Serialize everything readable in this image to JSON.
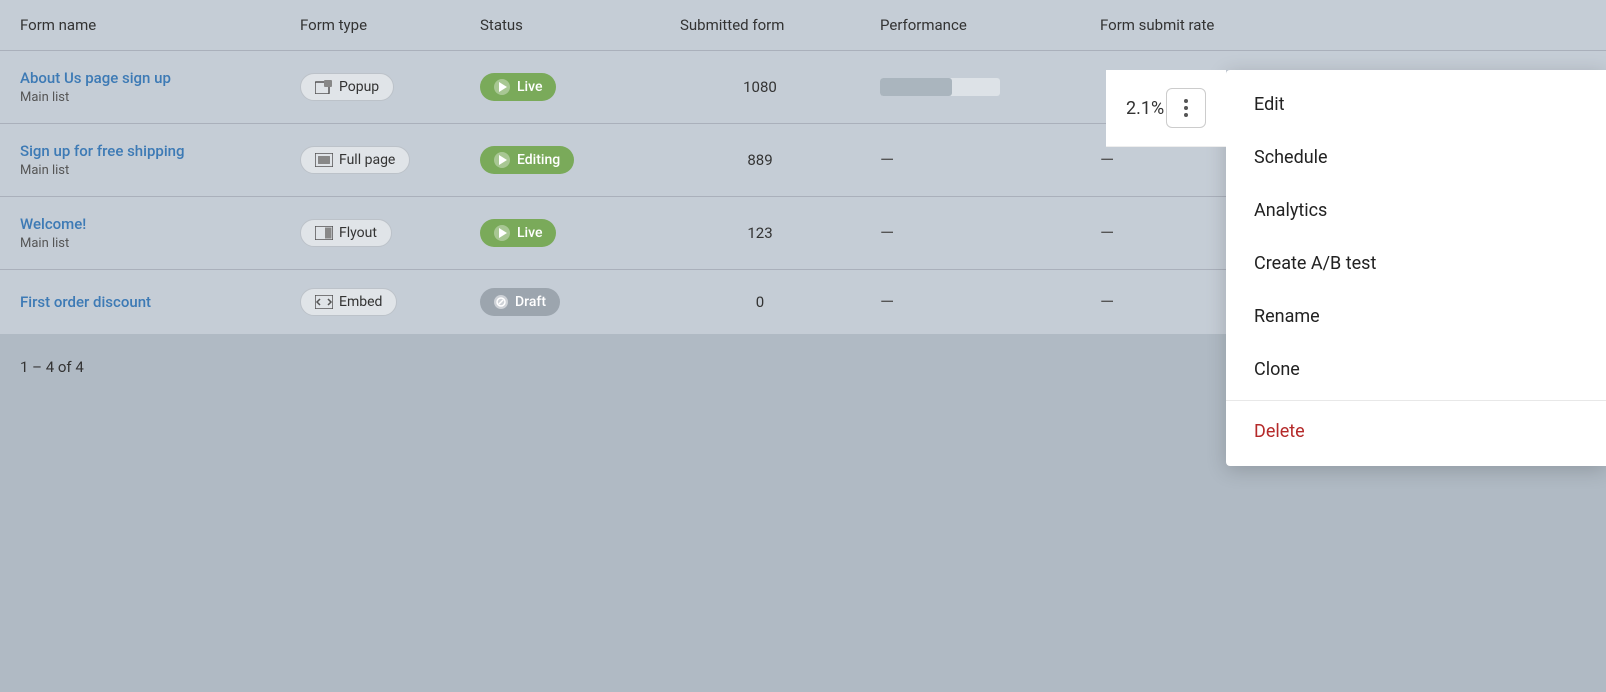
{
  "table": {
    "headers": {
      "form_name": "Form name",
      "form_type": "Form type",
      "status": "Status",
      "submitted_form": "Submitted form",
      "performance": "Performance",
      "form_submit_rate": "Form submit rate"
    },
    "rows": [
      {
        "id": "row-1",
        "name": "About Us page sign up",
        "subtext": "Main list",
        "type": "Popup",
        "type_icon": "popup-icon",
        "status": "Live",
        "status_class": "live",
        "submitted": "1080",
        "performance_pct": 60,
        "submit_rate": "2.1%",
        "has_three_dots": true
      },
      {
        "id": "row-2",
        "name": "Sign up for free shipping",
        "subtext": "Main list",
        "type": "Full page",
        "type_icon": "fullpage-icon",
        "status": "Editing",
        "status_class": "editing",
        "submitted": "889",
        "performance_pct": 0,
        "submit_rate": "—",
        "has_three_dots": false
      },
      {
        "id": "row-3",
        "name": "Welcome!",
        "subtext": "Main list",
        "type": "Flyout",
        "type_icon": "flyout-icon",
        "status": "Live",
        "status_class": "live",
        "submitted": "123",
        "performance_pct": 0,
        "submit_rate": "—",
        "has_three_dots": false
      },
      {
        "id": "row-4",
        "name": "First order discount",
        "subtext": "",
        "type": "Embed",
        "type_icon": "embed-icon",
        "status": "Draft",
        "status_class": "draft",
        "submitted": "0",
        "performance_pct": 0,
        "submit_rate": "—",
        "has_three_dots": false
      }
    ],
    "pagination": "1 – 4 of 4"
  },
  "dropdown": {
    "items": [
      {
        "id": "edit",
        "label": "Edit",
        "class": "normal"
      },
      {
        "id": "schedule",
        "label": "Schedule",
        "class": "normal"
      },
      {
        "id": "analytics",
        "label": "Analytics",
        "class": "normal"
      },
      {
        "id": "create-ab-test",
        "label": "Create A/B test",
        "class": "normal"
      },
      {
        "id": "rename",
        "label": "Rename",
        "class": "normal"
      },
      {
        "id": "clone",
        "label": "Clone",
        "class": "normal"
      },
      {
        "id": "delete",
        "label": "Delete",
        "class": "delete"
      }
    ],
    "rate_label": "2.1%"
  }
}
